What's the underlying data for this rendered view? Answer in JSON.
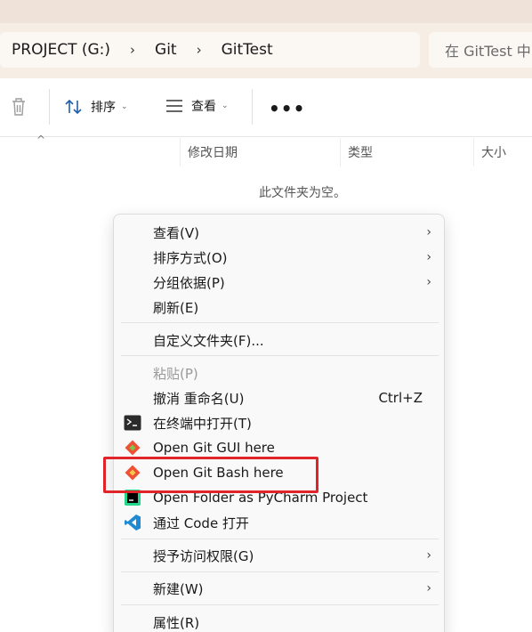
{
  "address": {
    "segments": [
      "PROJECT (G:)",
      "Git",
      "GitTest"
    ],
    "separator": "›",
    "search_placeholder": "在 GitTest 中"
  },
  "toolbar": {
    "sort_label": "排序",
    "view_label": "查看",
    "more_label": "•••"
  },
  "columns": {
    "date": "修改日期",
    "type": "类型",
    "size": "大小"
  },
  "empty_message": "此文件夹为空。",
  "menu": {
    "view": "查看(V)",
    "sort_by": "排序方式(O)",
    "group_by": "分组依据(P)",
    "refresh": "刷新(E)",
    "customize": "自定义文件夹(F)...",
    "paste": "粘贴(P)",
    "undo": "撤消 重命名(U)",
    "undo_shortcut": "Ctrl+Z",
    "open_terminal": "在终端中打开(T)",
    "git_gui": "Open Git GUI here",
    "git_bash": "Open Git Bash here",
    "pycharm": "Open Folder as PyCharm Project",
    "vscode": "通过 Code 打开",
    "give_access": "授予访问权限(G)",
    "new": "新建(W)",
    "properties": "属性(R)"
  },
  "colors": {
    "highlight": "#e0242a",
    "git": "#f05033",
    "vscode": "#1f8ad2"
  }
}
